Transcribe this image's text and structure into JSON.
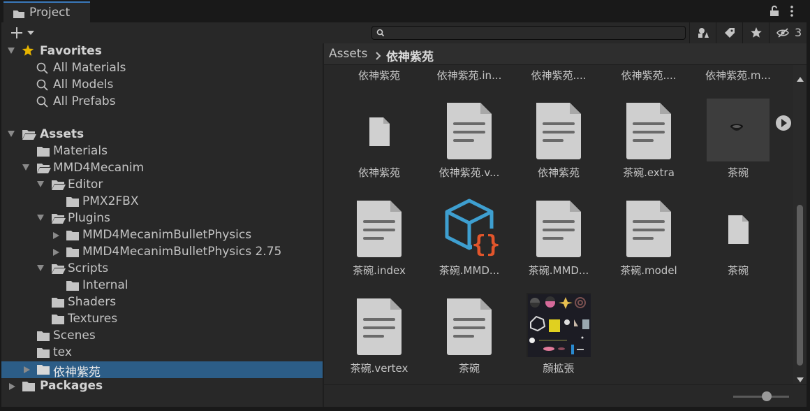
{
  "window": {
    "tab_title": "Project",
    "tab_icon": "folder-icon"
  },
  "toolbar": {
    "create_label": "+",
    "search_placeholder": "",
    "hidden_count": "3"
  },
  "tree": {
    "favorites": {
      "label": "Favorites",
      "items": [
        "All Materials",
        "All Models",
        "All Prefabs"
      ]
    },
    "assets": {
      "label": "Assets"
    },
    "items": [
      {
        "label": "Materials"
      },
      {
        "label": "MMD4Mecanim"
      },
      {
        "label": "Editor"
      },
      {
        "label": "PMX2FBX"
      },
      {
        "label": "Plugins"
      },
      {
        "label": "MMD4MecanimBulletPhysics"
      },
      {
        "label": "MMD4MecanimBulletPhysics 2.75"
      },
      {
        "label": "Scripts"
      },
      {
        "label": "Internal"
      },
      {
        "label": "Shaders"
      },
      {
        "label": "Textures"
      },
      {
        "label": "Scenes"
      },
      {
        "label": "tex"
      },
      {
        "label": "依神紫苑"
      }
    ],
    "packages": {
      "label": "Packages"
    }
  },
  "breadcrumb": {
    "root": "Assets",
    "current": "依神紫苑"
  },
  "grid": {
    "top_row_labels": [
      "依神紫苑",
      "依神紫苑.in...",
      "依神紫苑....",
      "依神紫苑....",
      "依神紫苑.m..."
    ],
    "items": [
      {
        "label": "依神紫苑",
        "icon": "blank-file-icon"
      },
      {
        "label": "依神紫苑.v...",
        "icon": "text-file-icon"
      },
      {
        "label": "依神紫苑",
        "icon": "text-file-icon"
      },
      {
        "label": "茶碗.extra",
        "icon": "text-file-icon"
      },
      {
        "label": "茶碗",
        "icon": "model-preview-icon"
      },
      {
        "label": "茶碗.index",
        "icon": "text-file-icon"
      },
      {
        "label": "茶碗.MMD...",
        "icon": "json-cube-icon"
      },
      {
        "label": "茶碗.MMD...",
        "icon": "text-file-icon"
      },
      {
        "label": "茶碗.model",
        "icon": "text-file-icon"
      },
      {
        "label": "茶碗",
        "icon": "blank-file-icon"
      },
      {
        "label": "茶碗.vertex",
        "icon": "text-file-icon"
      },
      {
        "label": "茶碗",
        "icon": "text-file-icon"
      },
      {
        "label": "顔拡張",
        "icon": "texture-preview-icon"
      }
    ]
  },
  "zoom": {
    "value": 0.6
  },
  "colors": {
    "selection": "#2c5d87",
    "accent": "#3a79bb",
    "star": "#e6b400",
    "json_blue": "#3e9fd0",
    "json_orange": "#e2552b"
  }
}
